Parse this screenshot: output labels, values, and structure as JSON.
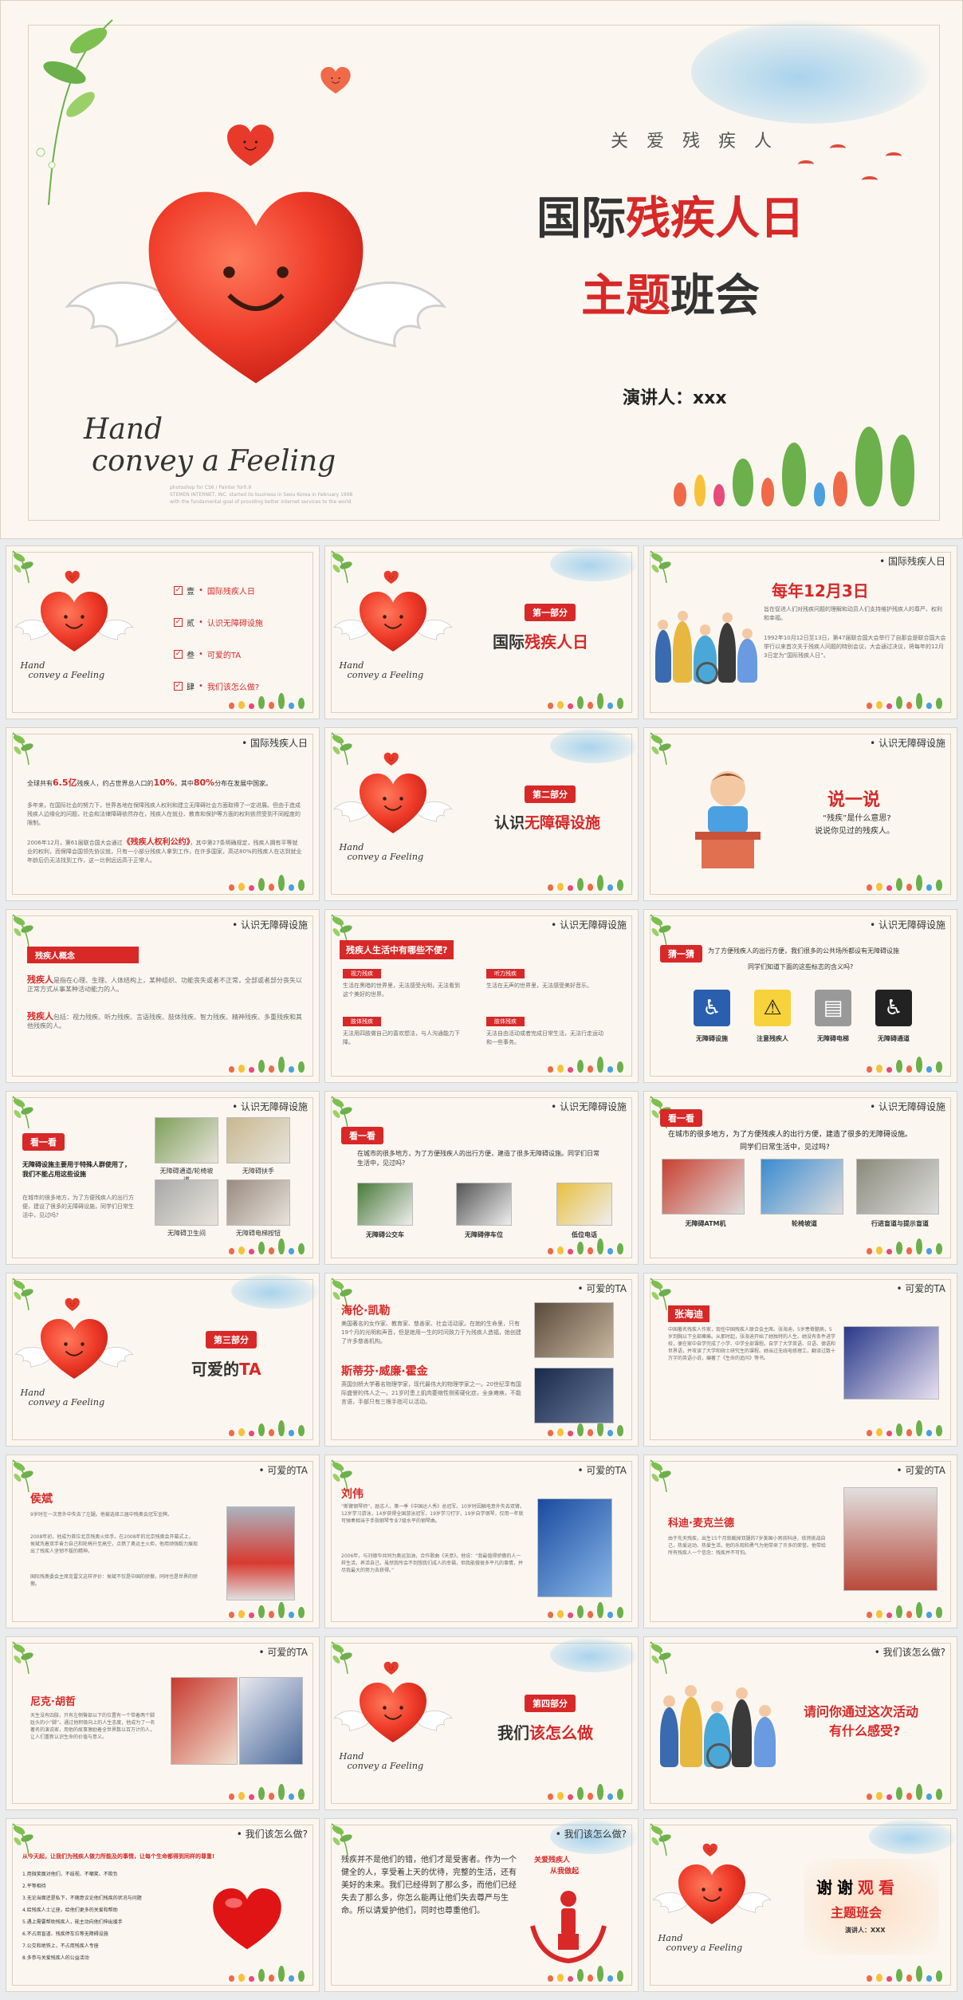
{
  "cover": {
    "subtitle": "关 爱 残 疾 人",
    "title_line1_a": "国际",
    "title_line1_b": "残疾人日",
    "title_line2_a": "主",
    "title_line2_b": "题",
    "title_line2_c": "班会",
    "speaker": "演讲人：xxx",
    "script_line1": "Hand",
    "script_line2": "convey a Feeling",
    "fine_print_1": "photoshop for CS6 / Painter for0.9",
    "fine_print_2": "STEMEN INTERNET, INC. started its business in Seou Korea in February 1998",
    "fine_print_3": "with the fundamental goal of providing better internet services to the world."
  },
  "toc": {
    "items": [
      {
        "num": "壹",
        "label": "国际残疾人日"
      },
      {
        "num": "贰",
        "label": "认识无障碍设施"
      },
      {
        "num": "叁",
        "label": "可爱的TA"
      },
      {
        "num": "肆",
        "label": "我们该怎么做?"
      }
    ]
  },
  "section1": {
    "badge": "第一部分",
    "title_a": "国际",
    "title_b": "残疾人日"
  },
  "section2": {
    "badge": "第二部分",
    "title_a": "认识",
    "title_b": "无障碍设施"
  },
  "section3": {
    "badge": "第三部分",
    "title_a": "可爱的",
    "title_b": "TA"
  },
  "section4": {
    "badge": "第四部分",
    "title_a": "我们",
    "title_b": "该怎么做"
  },
  "headers": {
    "s1": "国际残疾人日",
    "s2": "认识无障碍设施",
    "s3": "可爱的TA",
    "s4": "我们该怎么做?"
  },
  "dec3": {
    "title": "每年12月3日",
    "p1": "旨在促进人们对残疾问题的理解和动员人们支持维护残疾人的尊严、权利和幸福。",
    "p2": "1992年10月12日至13日，第47届联合国大会举行了自那会是联合国大会举行以来首次关于残疾人问题的特别会议，大会通过决议，将每年的12月3日定为“国际残疾人日”。"
  },
  "stats": {
    "line_a": "全球共有",
    "num1": "6.5亿",
    "line_b": "残疾人，约占世界总人口的",
    "num2": "10%",
    "line_c": "，其中",
    "num3": "80%",
    "line_d": "分布在发展中国家。",
    "p1": "多年来，在国际社会的努力下，世界各地在保障残疾人权利和建立无障碍社会方面取得了一定进展。但由于造成残疾人边缘化的问题，社会和法律障碍依然存在，残疾人在就业、教育和保护等方面的权利依然受到不同程度的限制。",
    "p2a": "2006年12月，第61届联合国大会通过",
    "p2b": "《残疾人权利公约》",
    "p2c": "，其中第27条明确规定，残疾人拥有平等就业的权利，而保障会国领先协议就，只有一小部分残疾人拿到工作，在许多国家，高达80%的残疾人在达到就业年龄后仍无法找到工作，这一比例远远高于正常人。"
  },
  "talk": {
    "title": "说一说",
    "q1": "“残疾”是什么意思?",
    "q2": "说说你见过的残疾人。"
  },
  "concept": {
    "pill": "残疾人概念",
    "p1a": "残疾人",
    "p1b": "是指在心理、生理、人体结构上，某种组织、功能丧失或者不正常，全部或者部分丧失以正常方式从事某种活动能力的人。",
    "p2a": "残疾人",
    "p2b": "包括：视力残疾、听力残疾、言语残疾、肢体残疾、智力残疾、精神残疾、多重残疾和其他残疾的人。"
  },
  "difficulty": {
    "title": "残疾人生活中有哪些不便?",
    "blocks": [
      {
        "label": "视力残疾",
        "text": "生活在黑暗的世界里，无法感受光明，无法看到这个美好的世界。"
      },
      {
        "label": "听力残疾",
        "text": "生活在无声的世界里，无法感受美好音乐。"
      },
      {
        "label": "肢体残疾",
        "text": "无法用四肢做自己的喜欢想法，与人沟通能力下降。"
      },
      {
        "label": "肢体残疾",
        "text": "无法自由活动或者完成日常生活，无法行走运动和一些事务。"
      }
    ]
  },
  "guess": {
    "pill": "猜一猜",
    "text1": "为了方便残疾人的出行方便，我们很多的公共场所都设有无障碍设施",
    "text2": "同学们知道下面的这些标志的含义吗?",
    "signs": [
      "无障碍设施",
      "注意残疾人",
      "无障碍电梯",
      "无障碍通道"
    ]
  },
  "look1": {
    "pill": "看一看",
    "bold1": "无障碍设施主要用于特殊人群使用了，我们不能占用这些设施",
    "text": "在城市的很多地方，为了方便残疾人的出行方便，建设了很多的无障碍设施，同学们日常生活中，见过吗?",
    "captions": [
      "无障碍通道/轮椅坡道",
      "无障碍扶手",
      "无障碍卫生间",
      "无障碍电梯按钮"
    ]
  },
  "look2": {
    "pill": "看一看",
    "text": "在城市的很多地方，为了方便残疾人的出行方便，建造了很多无障碍设施。同学们日常生活中，见过吗?",
    "captions": [
      "无障碍公交车",
      "无障碍停车位",
      "低位电话"
    ]
  },
  "look3": {
    "pill": "看一看",
    "text1": "在城市的很多地方，为了方便残疾人的出行方便，建造了很多的无障碍设施。",
    "text2": "同学们日常生活中，见过吗?",
    "captions": [
      "无障碍ATM机",
      "轮椅坡道",
      "行进盲道与提示盲道"
    ]
  },
  "helen": {
    "name1": "海伦·凯勒",
    "p1": "美国著名的女作家、教育家、慈善家、社会活动家。在她的生命里，只有19个月的光明和声音，但是她用一生的时间致力于为残疾人造福，她创建了许多慈善机构。",
    "name2": "斯蒂芬·威廉·霍金",
    "p2": "英国剑桥大学著名物理学家，现代最伟大的物理学家之一。20世纪享有国际盛誉的伟人之一。21岁时患上肌肉萎缩性侧索硬化症，全身瘫痪，不能言语，手部只有三根手指可以活动。"
  },
  "zhang": {
    "name": "张海迪",
    "p": "中国著名残疾人作家，现任中国残疾人联合会主席。张海迪，5岁患脊髓病，5岁到胸以下全部瘫痪。从那时起，张海迪开始了她独特的人生。她没有条件进学校，便在家中自学完成了小学、中学全部课程。自学了大学英语、日语、德语和世界语，并攻读了大学和硕士研究生的课程。她当过无线电修理工，翻译过数十万字的英语小说，编著了《生命的追问》等书。"
  },
  "houbin": {
    "name": "侯斌",
    "p1": "9岁时在一次意外中失去了左腿。他被选择三届中残奥会冠军金牌。",
    "p2": "2008年初，他成为首位北京残奥火炬手。在2008年的北京残奥会开幕式上，侯斌凭着双手奋力自己和轮椅升至高空，点燃了奥运主火炬，他用顽强毅力展现出了残疾人坚韧不拔的精神。",
    "p3": "国际残奥委会主席克雷文这样评价：侯斌不仅是中国的骄傲，同时也是世界的骄傲。"
  },
  "liuwei": {
    "name": "刘伟",
    "p1": "“断臂钢琴师”，励志人，第一季《中国达人秀》总冠军。10岁时因触电意外失去双臂。12岁学习游泳，14岁获得全国游泳冠军，19岁学习打字，19岁自学钢琴，仅用一年就可弹奏相当于手指钢琴专业7级水平的钢琴曲。",
    "p2": "2006年，与刘德华共同为奥运加油，合作歌曲《天意》。他说：“我最值得骄傲的人一样生活，养活自己，虽然我所会不到想我们成人的幸福，但我能做很多平凡的事情，并尽我最大的努力去获得。”"
  },
  "ricardo": {
    "name": "科迪·麦克兰德",
    "p": "由于先天残疾，出生15个月就截掉双腿的7岁美国小男孩科迪，依然挑战自己，热爱运动、热爱生活，他的乐观和勇气为他带来了许多的荣誉。他带给所有残疾人一个信念：残疾并不可怕。"
  },
  "nick": {
    "name": "尼克·胡哲",
    "p": "天生没有四肢，只有左侧臀部以下的位置有一个带着两个脚趾头的小“脚”。通过他积极向上的人生态度，他成为了一名著名的演说家，用他的故事激励着全世界数以百万计的人，让人们重新认识生命的价值与意义。"
  },
  "feeling": {
    "q1": "请问你通过这次活动",
    "q2": "有什么感受?"
  },
  "action": {
    "intro": "从今天起，让我们为残疾人做力所能及的事情，让每个生命都得到同样的尊重!",
    "items": [
      "1.用微笑面对他们、不歧视、不嘲笑、不欺负",
      "2.平等相待",
      "3.无论当面还是私下，不随意议论他们残疾的状况与问题",
      "4.给残疾人士让座，给他们更多的关爱和帮助",
      "5.遇上需要帮助残疾人，能主动向他们伸出援手",
      "6.不占用盲道、残疾停车位等无障碍设施",
      "7.公交和地铁上，不占用残疾人专座",
      "8.多参与关爱残疾人的公益活动"
    ]
  },
  "poem": {
    "text": "残疾并不是他们的错，他们才是受害者。作为一个健全的人，享受着上天的优待，完整的生活，还有美好的未来。我们已经得到了那么多，而他们已经失去了那么多，你怎么能再让他们失去尊严与生命。所以请爱护他们，同时也尊重他们。",
    "badge1": "关爱残疾人",
    "badge2": "从我做起"
  },
  "thanks": {
    "a": "谢",
    "b": "谢",
    "c": "观",
    "d": "看",
    "line2": "主题班会",
    "speaker": "演讲人：XXX"
  },
  "colors": {
    "accent": "#d82828",
    "paper": "#fbf7f0",
    "sky": "#92c9ec",
    "leaf": "#6bb04a"
  }
}
